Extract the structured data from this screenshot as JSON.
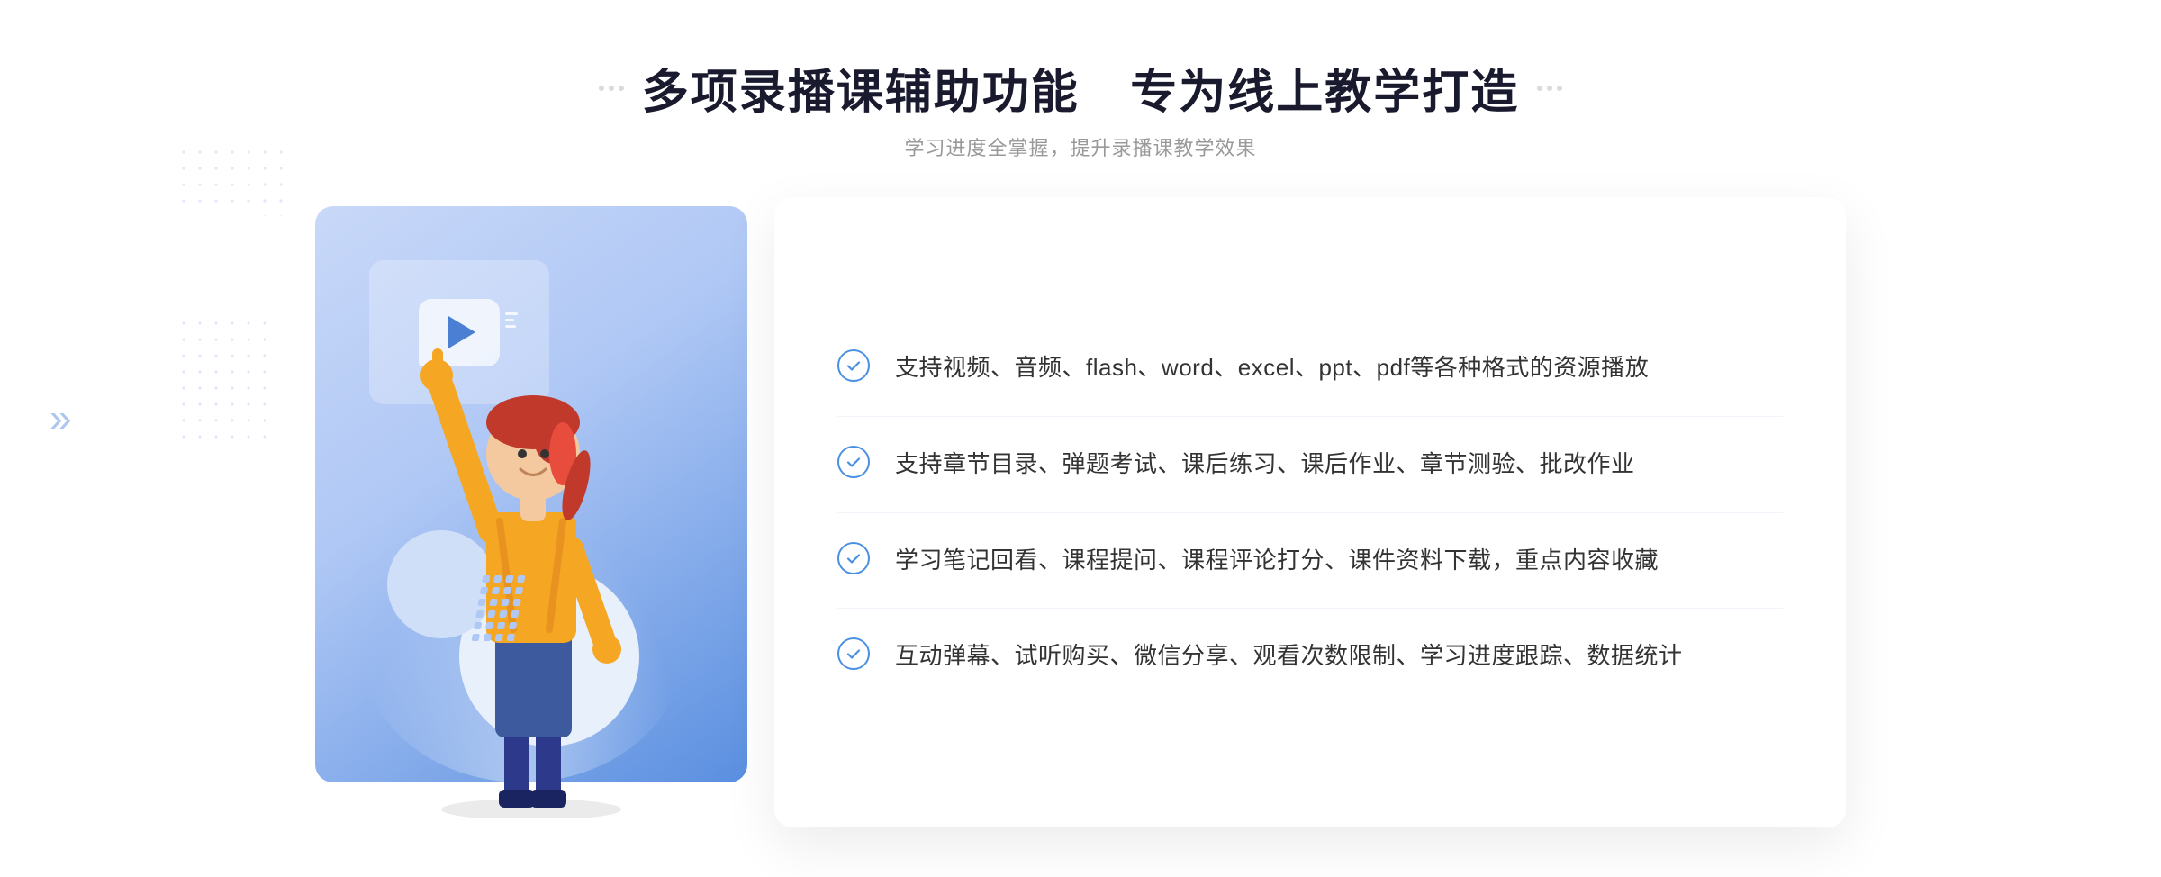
{
  "header": {
    "title_part1": "多项录播课辅助功能",
    "title_part2": "专为线上教学打造",
    "subtitle": "学习进度全掌握，提升录播课教学效果"
  },
  "features": [
    {
      "id": 1,
      "text": "支持视频、音频、flash、word、excel、ppt、pdf等各种格式的资源播放"
    },
    {
      "id": 2,
      "text": "支持章节目录、弹题考试、课后练习、课后作业、章节测验、批改作业"
    },
    {
      "id": 3,
      "text": "学习笔记回看、课程提问、课程评论打分、课件资料下载，重点内容收藏"
    },
    {
      "id": 4,
      "text": "互动弹幕、试听购买、微信分享、观看次数限制、学习进度跟踪、数据统计"
    }
  ],
  "colors": {
    "accent_blue": "#4a7fd4",
    "light_blue": "#b0c8f5",
    "text_dark": "#1a1a2e",
    "text_mid": "#333333",
    "text_light": "#999999"
  }
}
